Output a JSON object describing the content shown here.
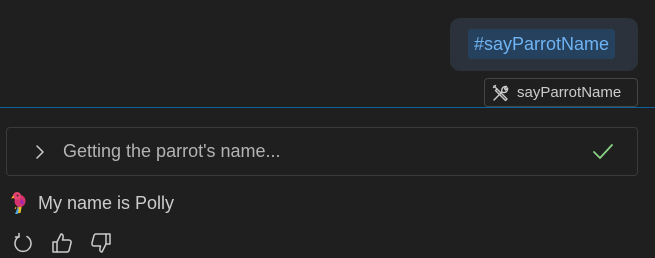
{
  "request": {
    "tool_reference": "#sayParrotName",
    "tool_chip": {
      "icon": "tools-icon",
      "label": "sayParrotName"
    }
  },
  "progress": {
    "icon": "chevron-right-icon",
    "label": "Getting the parrot's name...",
    "status_icon": "check-icon",
    "status_color": "#89d185"
  },
  "response": {
    "avatar_icon": "parrot-icon",
    "text": "My name is Polly"
  },
  "actions": [
    {
      "icon": "retry-icon"
    },
    {
      "icon": "thumbs-up-icon"
    },
    {
      "icon": "thumbs-down-icon"
    }
  ],
  "colors": {
    "background": "#1f1f1f",
    "user_bubble": "#2b323b",
    "tool_reference_bg": "#26415e",
    "tool_reference_text": "#6fb3f2",
    "divider": "#0e639c"
  }
}
